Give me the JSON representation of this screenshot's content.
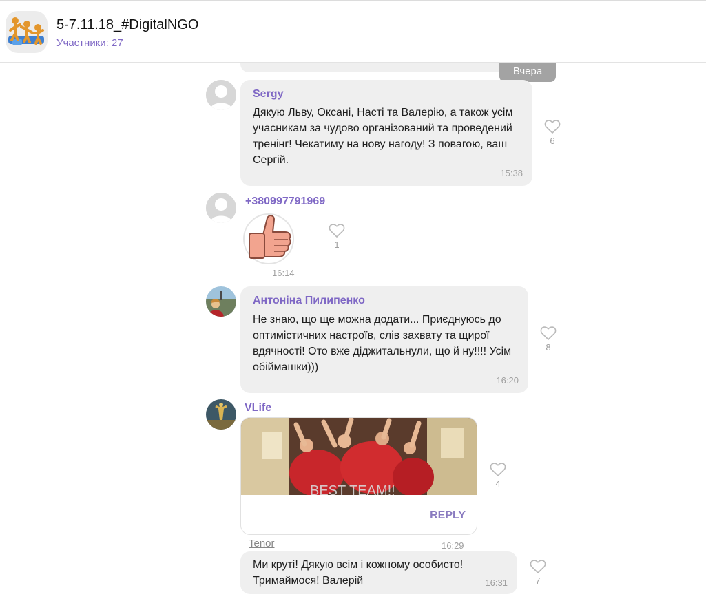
{
  "header": {
    "group_name": "5-7.11.18_#DigitalNGO",
    "members": "Участники: 27"
  },
  "date_separator": "Вчера",
  "messages": [
    {
      "sender": "Sergy",
      "text_lines": [
        "Дякую Льву, Оксані, Насті  та Валерію, а також усім",
        "учасникам за чудово організований та проведений",
        "тренінг! Чекатиму на нову нагоду! З повагою, ваш",
        "Сергій."
      ],
      "time": "15:38",
      "likes": "6"
    },
    {
      "sender": "+380997791969",
      "sticker": "thumbs-up",
      "time": "16:14",
      "likes": "1"
    },
    {
      "sender": "Антоніна Пилипенко",
      "text_lines": [
        "Не знаю, що ще можна додати... Приєднуюсь до",
        "оптимістичних настроїв, слів захвату та щирої",
        "вдячності! Ото вже діджитальнули, що й ну!!!! Усім",
        "обіймашки)))"
      ],
      "time": "16:20",
      "likes": "8"
    },
    {
      "sender": "VLife",
      "gif_caption": "BEST TEAM!!",
      "reply_label": "REPLY",
      "gif_source": "Tenor",
      "time": "16:29",
      "likes": "4"
    },
    {
      "text_lines": [
        "Ми круті! Дякую всім і кожному особисто!",
        "Тримаймося! Валерій"
      ],
      "time": "16:31",
      "likes": "7"
    }
  ],
  "colors": {
    "accent": "#7f68c5",
    "bubble": "#efefef",
    "muted": "#a0a0a0"
  }
}
